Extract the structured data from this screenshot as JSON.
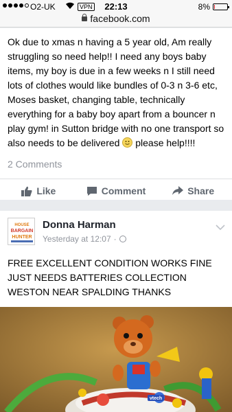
{
  "status": {
    "carrier": "O2-UK",
    "vpn": "VPN",
    "time": "22:13",
    "battery": "8%",
    "battery_level": 0.08
  },
  "url": "facebook.com",
  "post1": {
    "text": "Ok due to xmas n having a 5 year old, Am really struggling so need help!! I need any boys baby items, my boy is due in a few weeks n I still need lots of clothes would like bundles of 0-3 n 3-6 etc, Moses basket, changing table, technically everything for a baby boy apart from a bouncer n play gym! in Sutton bridge with no one transport so also needs to be delivered",
    "text_end": "please help!!!!",
    "comments": "2 Comments",
    "actions": {
      "like": "Like",
      "comment": "Comment",
      "share": "Share"
    }
  },
  "post2": {
    "author": "Donna Harman",
    "time": "Yesterday at 12:07",
    "separator": "·",
    "text": "FREE EXCELLENT CONDITION WORKS FINE JUST NEEDS BATTERIES COLLECTION WESTON NEAR SPALDING THANKS",
    "avatar_text": [
      "HOUSE",
      "BARGAIN",
      "HUNTER"
    ],
    "photo_brand": "vtech"
  }
}
